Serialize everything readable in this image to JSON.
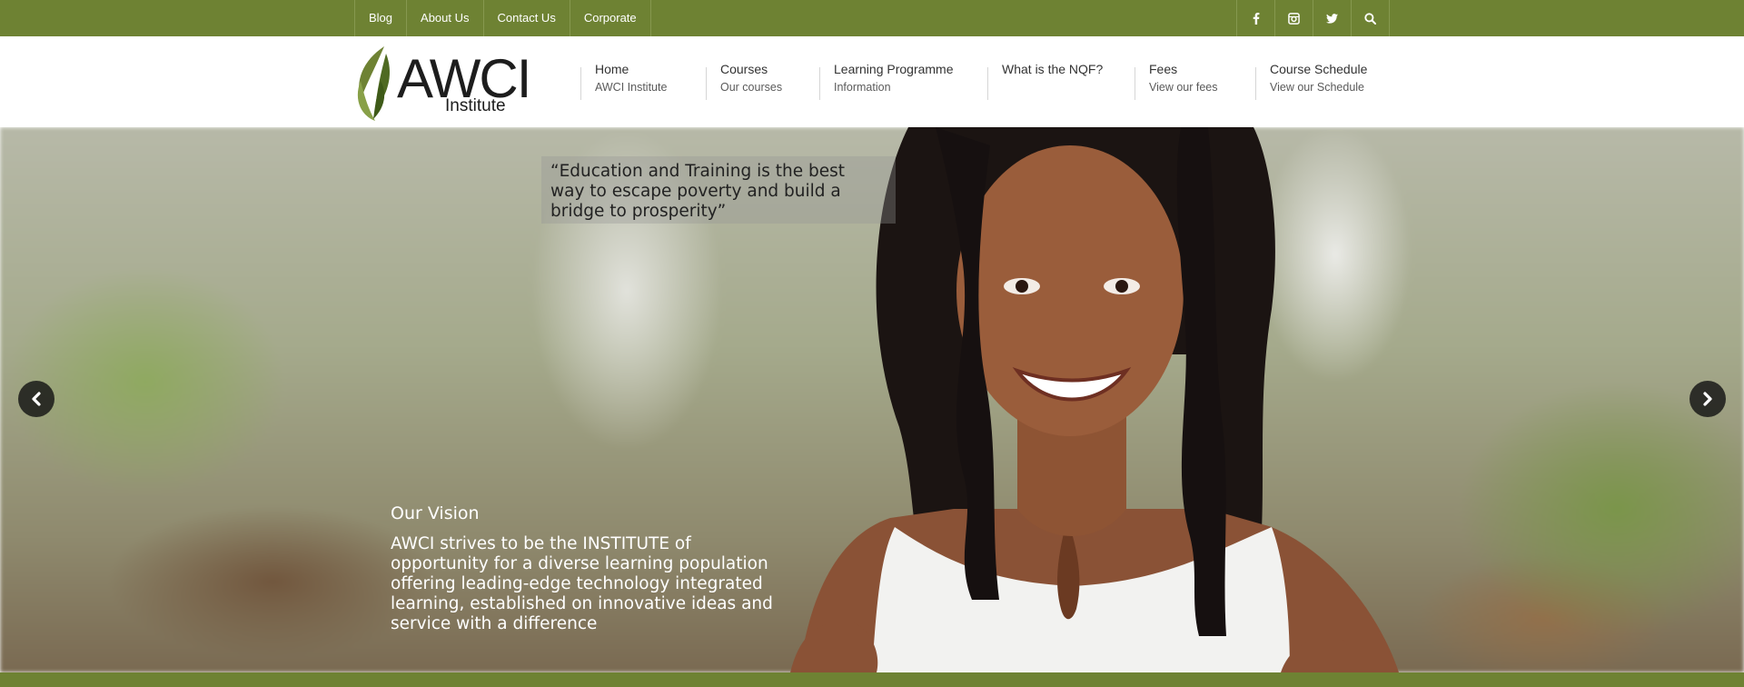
{
  "topbar": {
    "links": [
      "Blog",
      "About Us",
      "Contact Us",
      "Corporate"
    ],
    "socials": [
      "facebook-icon",
      "instagram-icon",
      "twitter-icon",
      "search-icon"
    ]
  },
  "logo": {
    "word": "AWCI",
    "sub": "Institute"
  },
  "nav": [
    {
      "title": "Home",
      "sub": "AWCI Institute"
    },
    {
      "title": "Courses",
      "sub": "Our courses"
    },
    {
      "title": "Learning Programme",
      "sub": "Information"
    },
    {
      "title": "What is the NQF?",
      "sub": ""
    },
    {
      "title": "Fees",
      "sub": "View our fees"
    },
    {
      "title": "Course Schedule",
      "sub": "View our Schedule"
    }
  ],
  "hero": {
    "quote": "“Education and Training is the best way to escape poverty and build a bridge to prosperity”",
    "vision_title": "Our Vision",
    "vision_text": "AWCI strives to be the INSTITUTE of opportunity for a diverse learning population offering leading-edge technology integrated learning, established on innovative ideas and service with a difference"
  },
  "colors": {
    "brand_green": "#6e8233"
  }
}
